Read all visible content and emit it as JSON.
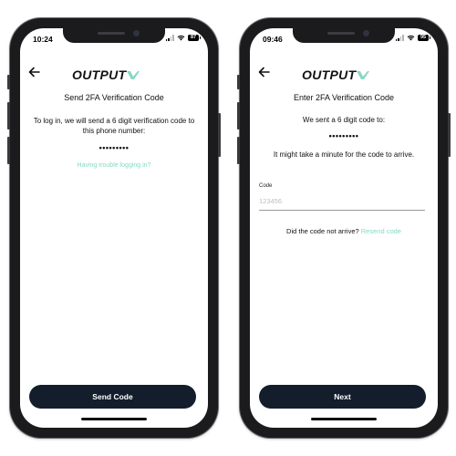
{
  "colors": {
    "accent": "#86d8c4",
    "button_bg": "#141d2b",
    "phone_frame": "#1b1b1d"
  },
  "brand": {
    "name": "OUTPUT"
  },
  "screens": [
    {
      "status": {
        "time": "10:24",
        "battery": "87"
      },
      "title": "Send 2FA Verification Code",
      "description": "To log in, we will send a 6 digit verification code to this phone number:",
      "masked_phone": "•••••••••",
      "trouble_link": "Having trouble logging in?",
      "button_label": "Send Code"
    },
    {
      "status": {
        "time": "09:46",
        "battery": "95"
      },
      "title": "Enter 2FA Verification Code",
      "sent_text": "We sent a 6 digit code to:",
      "masked_phone": "•••••••••",
      "wait_text": "It might take a minute for the code to arrive.",
      "code_label": "Code",
      "code_placeholder": "123456",
      "code_value": "",
      "not_arrived_text": "Did the code not arrive?",
      "resend_link": "Resend code",
      "button_label": "Next"
    }
  ]
}
